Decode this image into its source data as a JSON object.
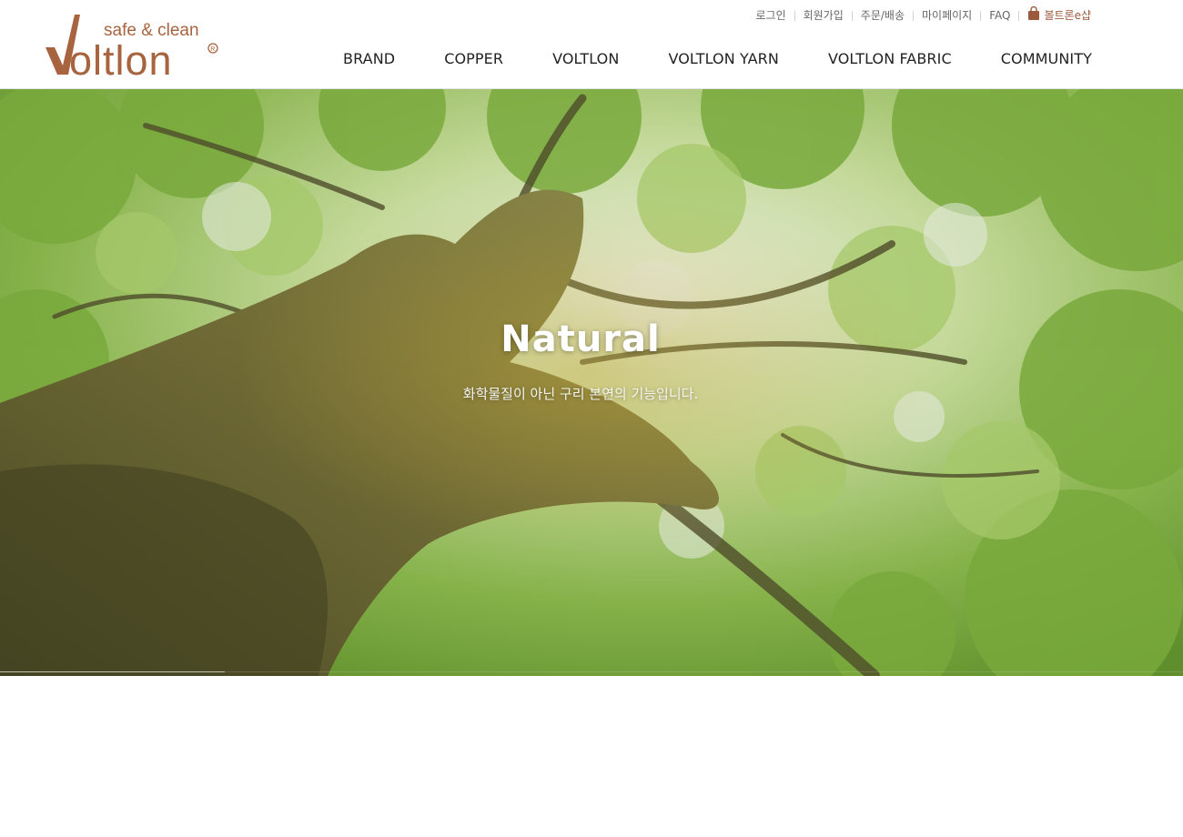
{
  "brand": {
    "tagline": "safe & clean",
    "wordmark": "Voltlon",
    "registered": "®",
    "color": "#a8633f"
  },
  "util_nav": {
    "items": [
      {
        "label": "로그인"
      },
      {
        "label": "회원가입"
      },
      {
        "label": "주문/배송"
      },
      {
        "label": "마이페이지"
      },
      {
        "label": "FAQ"
      }
    ],
    "shop": {
      "label": "볼트론e샵",
      "icon": "shopping-bag-icon",
      "color": "#9c5a3d"
    }
  },
  "gnb": {
    "items": [
      {
        "label": "BRAND"
      },
      {
        "label": "COPPER"
      },
      {
        "label": "VOLTLON"
      },
      {
        "label": "VOLTLON YARN"
      },
      {
        "label": "VOLTLON FABRIC"
      },
      {
        "label": "COMMUNITY"
      }
    ]
  },
  "hero": {
    "title": "Natural",
    "subtitle": "화학물질이 아닌 구리 본연의 기능입니다.",
    "progress": 0.19
  }
}
